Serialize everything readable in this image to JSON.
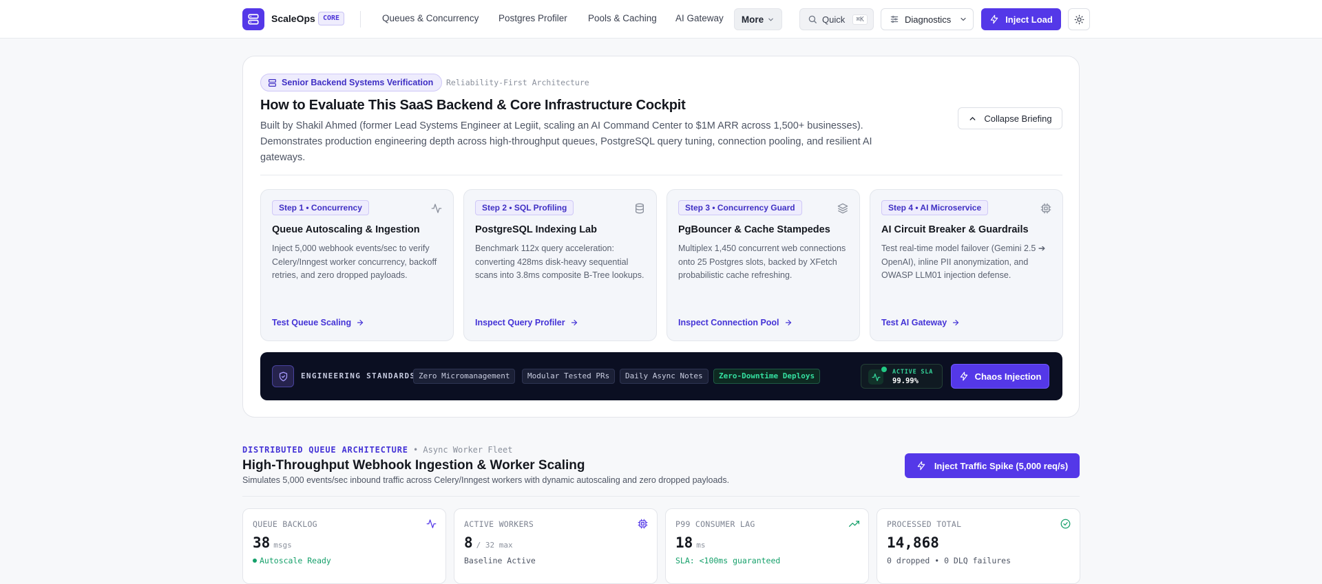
{
  "brand": {
    "name": "ScaleOps",
    "tag": "CORE"
  },
  "nav": {
    "items": [
      "Queues & Concurrency",
      "Postgres Profiler",
      "Pools & Caching",
      "AI Gateway"
    ],
    "more_label": "More",
    "quick_label": "Quick",
    "quick_shortcut": "⌘K",
    "diagnostics_label": "Diagnostics",
    "inject_label": "Inject Load"
  },
  "briefing": {
    "pill": "Senior Backend Systems Verification",
    "arch_tag": "Reliability-First Architecture",
    "title": "How to Evaluate This SaaS Backend & Core Infrastructure Cockpit",
    "description": "Built by Shakil Ahmed (former Lead Systems Engineer at Legiit, scaling an AI Command Center to $1M ARR across 1,500+ businesses). Demonstrates production engineering depth across high-throughput queues, PostgreSQL query tuning, connection pooling, and resilient AI gateways.",
    "collapse_label": "Collapse Briefing",
    "steps": [
      {
        "chip": "Step 1 • Concurrency",
        "icon": "activity-icon",
        "title": "Queue Autoscaling & Ingestion",
        "body": "Inject 5,000 webhook events/sec to verify Celery/Inngest worker concurrency, backoff retries, and zero dropped payloads.",
        "link": "Test Queue Scaling"
      },
      {
        "chip": "Step 2 • SQL Profiling",
        "icon": "database-icon",
        "title": "PostgreSQL Indexing Lab",
        "body": "Benchmark 112x query acceleration: converting 428ms disk-heavy sequential scans into 3.8ms composite B-Tree lookups.",
        "link": "Inspect Query Profiler"
      },
      {
        "chip": "Step 3 • Concurrency Guard",
        "icon": "layers-icon",
        "title": "PgBouncer & Cache Stampedes",
        "body": "Multiplex 1,450 concurrent web connections onto 25 Postgres slots, backed by XFetch probabilistic cache refreshing.",
        "link": "Inspect Connection Pool"
      },
      {
        "chip": "Step 4 • AI Microservice",
        "icon": "cpu-icon",
        "title": "AI Circuit Breaker & Guardrails",
        "body": "Test real-time model failover (Gemini 2.5 ➔ OpenAI), inline PII anonymization, and OWASP LLM01 injection defense.",
        "link": "Test AI Gateway"
      }
    ],
    "standards": {
      "label": "ENGINEERING STANDARDS",
      "chips": [
        "Zero Micromanagement",
        "Modular Tested PRs",
        "Daily Async Notes",
        "Zero-Downtime Deploys"
      ],
      "sla_label": "ACTIVE SLA",
      "sla_value": "99.99%",
      "chaos_label": "Chaos Injection"
    }
  },
  "queue_section": {
    "kicker": "DISTRIBUTED QUEUE ARCHITECTURE",
    "kicker_sub": "• Async Worker Fleet",
    "title": "High-Throughput Webhook Ingestion & Worker Scaling",
    "description": "Simulates 5,000 events/sec inbound traffic across Celery/Inngest workers with dynamic autoscaling and zero dropped payloads.",
    "spike_label": "Inject Traffic Spike (5,000 req/s)",
    "metrics": [
      {
        "label": "QUEUE BACKLOG",
        "value": "38",
        "unit": "msgs",
        "sub": "Autoscale Ready",
        "icon": "activity-icon"
      },
      {
        "label": "ACTIVE WORKERS",
        "value": "8",
        "unit": "/ 32 max",
        "sub": "Baseline Active",
        "icon": "cpu-icon"
      },
      {
        "label": "P99 CONSUMER LAG",
        "value": "18",
        "unit": "ms",
        "sub": "SLA: <100ms guaranteed",
        "icon": "trending-up-icon"
      },
      {
        "label": "PROCESSED TOTAL",
        "value": "14,868",
        "unit": "",
        "sub": "0 dropped • 0 DLQ failures",
        "icon": "check-circle-icon"
      }
    ]
  },
  "colors": {
    "accent": "#5438e8",
    "success": "#15a06a",
    "dark_panel": "#0b0f22"
  }
}
